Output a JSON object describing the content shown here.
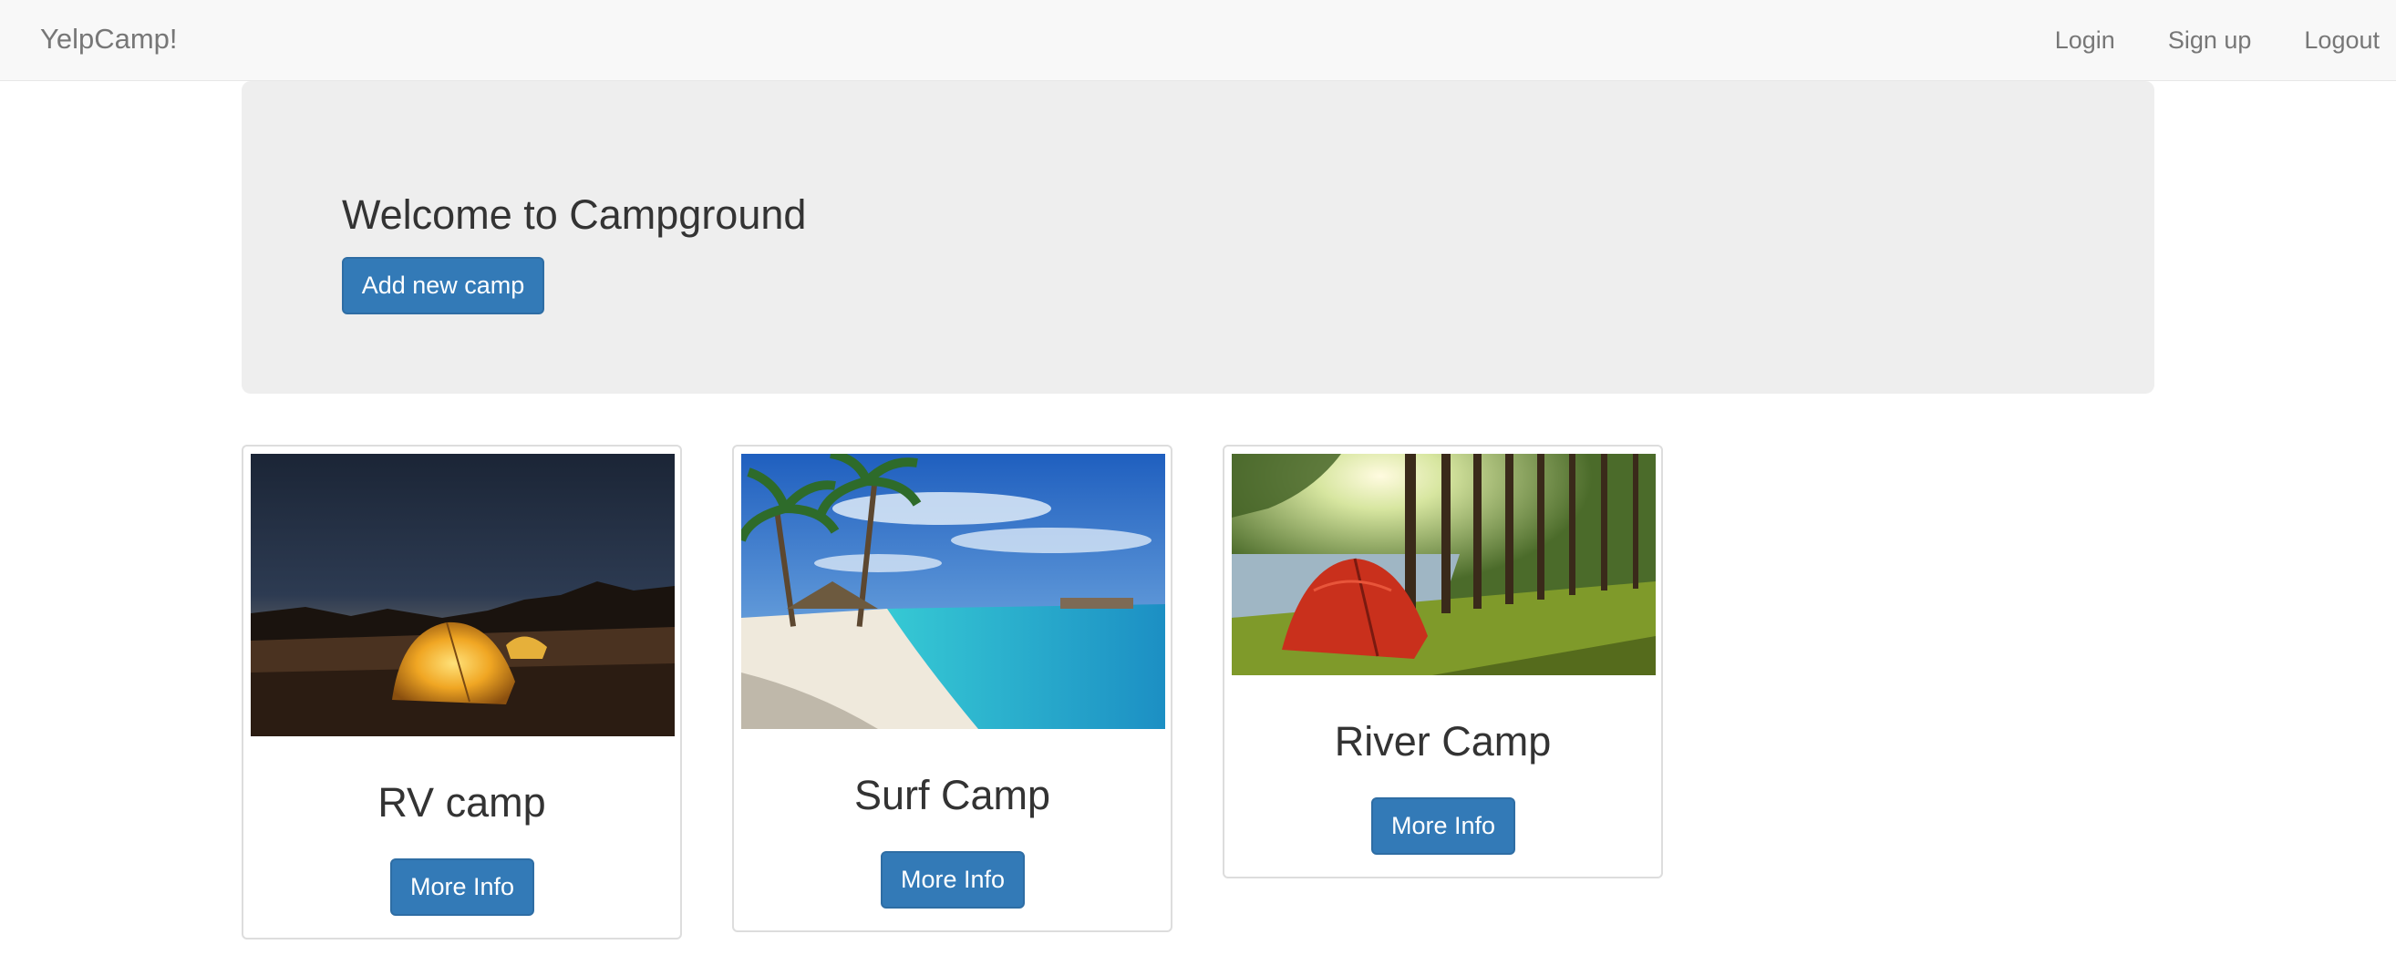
{
  "navbar": {
    "brand": "YelpCamp!",
    "links": [
      "Login",
      "Sign up",
      "Logout"
    ]
  },
  "jumbotron": {
    "title": "Welcome to Campground",
    "button_label": "Add new camp"
  },
  "campgrounds": [
    {
      "name": "RV camp",
      "button_label": "More Info",
      "image": "night-tent-under-stars"
    },
    {
      "name": "Surf Camp",
      "button_label": "More Info",
      "image": "tropical-beach-with-palms"
    },
    {
      "name": "River Camp",
      "button_label": "More Info",
      "image": "red-tent-in-forest-by-river"
    }
  ],
  "colors": {
    "primary": "#337ab7",
    "navbar_bg": "#f8f8f8",
    "jumbotron_bg": "#eeeeee"
  }
}
